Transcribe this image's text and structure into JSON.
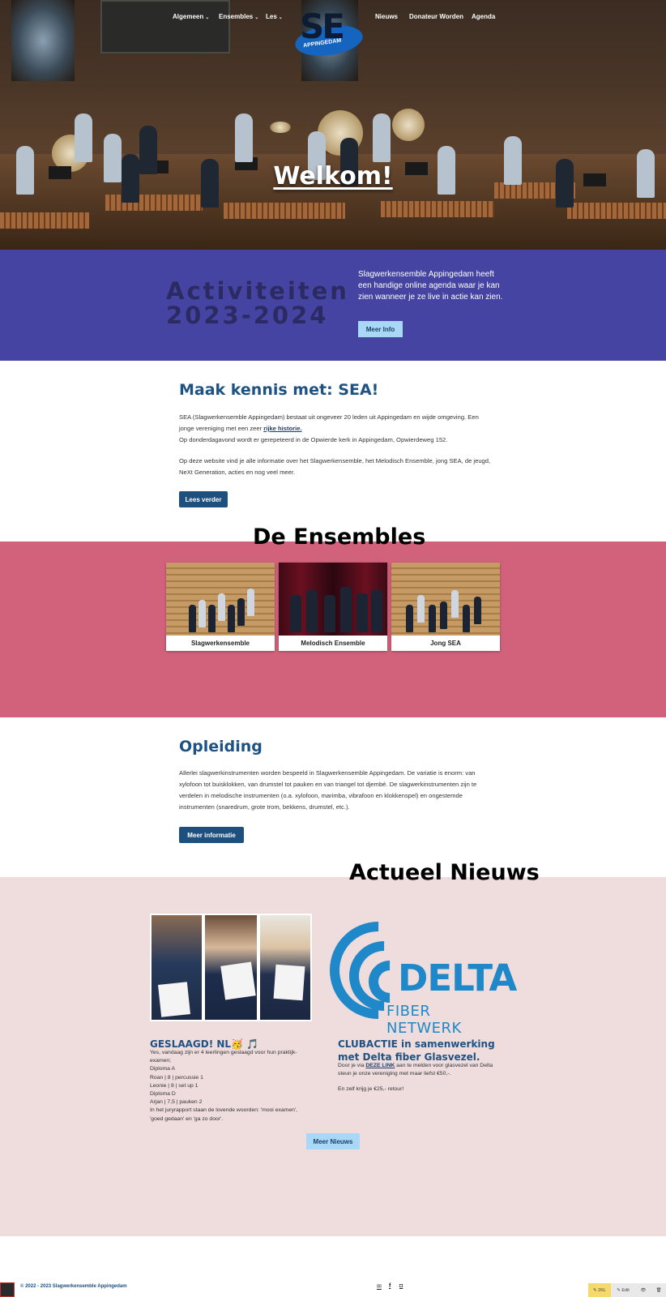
{
  "nav": {
    "left": [
      {
        "label": "Algemeen",
        "dropdown": true
      },
      {
        "label": "Ensembles",
        "dropdown": true
      },
      {
        "label": "Les",
        "dropdown": true
      }
    ],
    "right": [
      {
        "label": "Nieuws"
      },
      {
        "label": "Donateur Worden"
      },
      {
        "label": "Agenda"
      }
    ],
    "chevron": "⌄"
  },
  "logo": {
    "letters": "SE",
    "subtitle": "APPINGEDAM"
  },
  "hero": {
    "title": "Welkom!"
  },
  "activities": {
    "title": "Activiteiten 2023-2024",
    "text": "Slagwerkensemble Appingedam heeft een handige online agenda waar je kan zien wanneer je ze live in actie kan zien.",
    "button": "Meer Info"
  },
  "intro": {
    "title": "Maak kennis met: SEA!",
    "p1_before_link": "SEA (Slagwerkensemble Appingedam) bestaat uit ongeveer 20 leden uit Appingedam en wijde omgeving. Een jonge vereniging met een zeer ",
    "p1_link": "rijke historie.",
    "p1_after": "Op donderdagavond wordt er gerepeteerd in de Opwierde kerk in Appingedam, Opwierdeweg 152.",
    "p2": "Op deze website vind je alle informatie over het Slagwerkensemble, het Melodisch Ensemble, jong SEA, de jeugd, NeXt Generation, acties en nog veel meer.",
    "button": "Lees verder"
  },
  "ensembles": {
    "title": "De Ensembles",
    "cards": [
      {
        "label": "Slagwerkensemble"
      },
      {
        "label": "Melodisch Ensemble"
      },
      {
        "label": "Jong SEA"
      }
    ]
  },
  "opleiding": {
    "title": "Opleiding",
    "text": "Allerlei slagwerkinstrumenten worden bespeeld in Slagwerkensemble Appingedam. De variatie is enorm: van xylofoon tot buisklokken, van drumstel tot pauken en van triangel tot djembé. De slagwerkinstrumenten zijn te verdelen in melodische instrumenten (o.a. xylofoon, marimba, vibrafoon en klokkenspel) en ongestemde instrumenten (snaredrum, grote trom, bekkens, drumstel, etc.).",
    "button": "Meer informatie"
  },
  "news": {
    "title": "Actueel Nieuws",
    "items": [
      {
        "title": "GESLAAGD! NL🥳 🎵",
        "lines": [
          "Yes, vandaag zijn er 4 leerlingen geslaagd voor hun praktijk-examen;",
          "Diploma A",
          "Roan | 8 | percussie 1",
          "Leonie | 8 | set up 1",
          "Diploma D",
          "Arjan | 7,5 | pauken 2",
          "In het juryrapport staan de lovende woorden: 'mooi examen', 'goed gedaan' en 'ga zo door'."
        ]
      },
      {
        "title": "CLUBACTIE in samenwerking met Delta fiber Glasvezel.",
        "text_before_link": "Door je via ",
        "link": "DEZE LINK",
        "text_after_link": " aan te melden voor glasvezel van Delta steun je onze vereniging met maar liefst €50,-.",
        "text2": "En zelf krijg je €25,- retour!",
        "image_word": "DELTA",
        "image_sub": "FIBER NETWERK"
      }
    ],
    "button": "Meer Nieuws"
  },
  "footer": {
    "copyright": "© 2022 - 2023 Slagwerkensemble Appingedam",
    "social": [
      {
        "icon": "mail-icon",
        "glyph": "✉"
      },
      {
        "icon": "facebook-icon",
        "glyph": "f"
      },
      {
        "icon": "instagram-icon",
        "glyph": "◘"
      }
    ]
  },
  "admin_toolbar": {
    "items": [
      {
        "label": "✎ 2KL"
      },
      {
        "label": "✎ Edit"
      },
      {
        "label": "👁"
      },
      {
        "label": "🗑"
      }
    ]
  },
  "colors": {
    "activity_bg": "#4544a2",
    "ensembles_bg": "#d2627c",
    "news_bg": "#efdcdc",
    "heading_blue": "#1e5282",
    "button_dark": "#1d4f7f",
    "button_light": "#a8d8f5",
    "delta_blue": "#1e88c8"
  }
}
